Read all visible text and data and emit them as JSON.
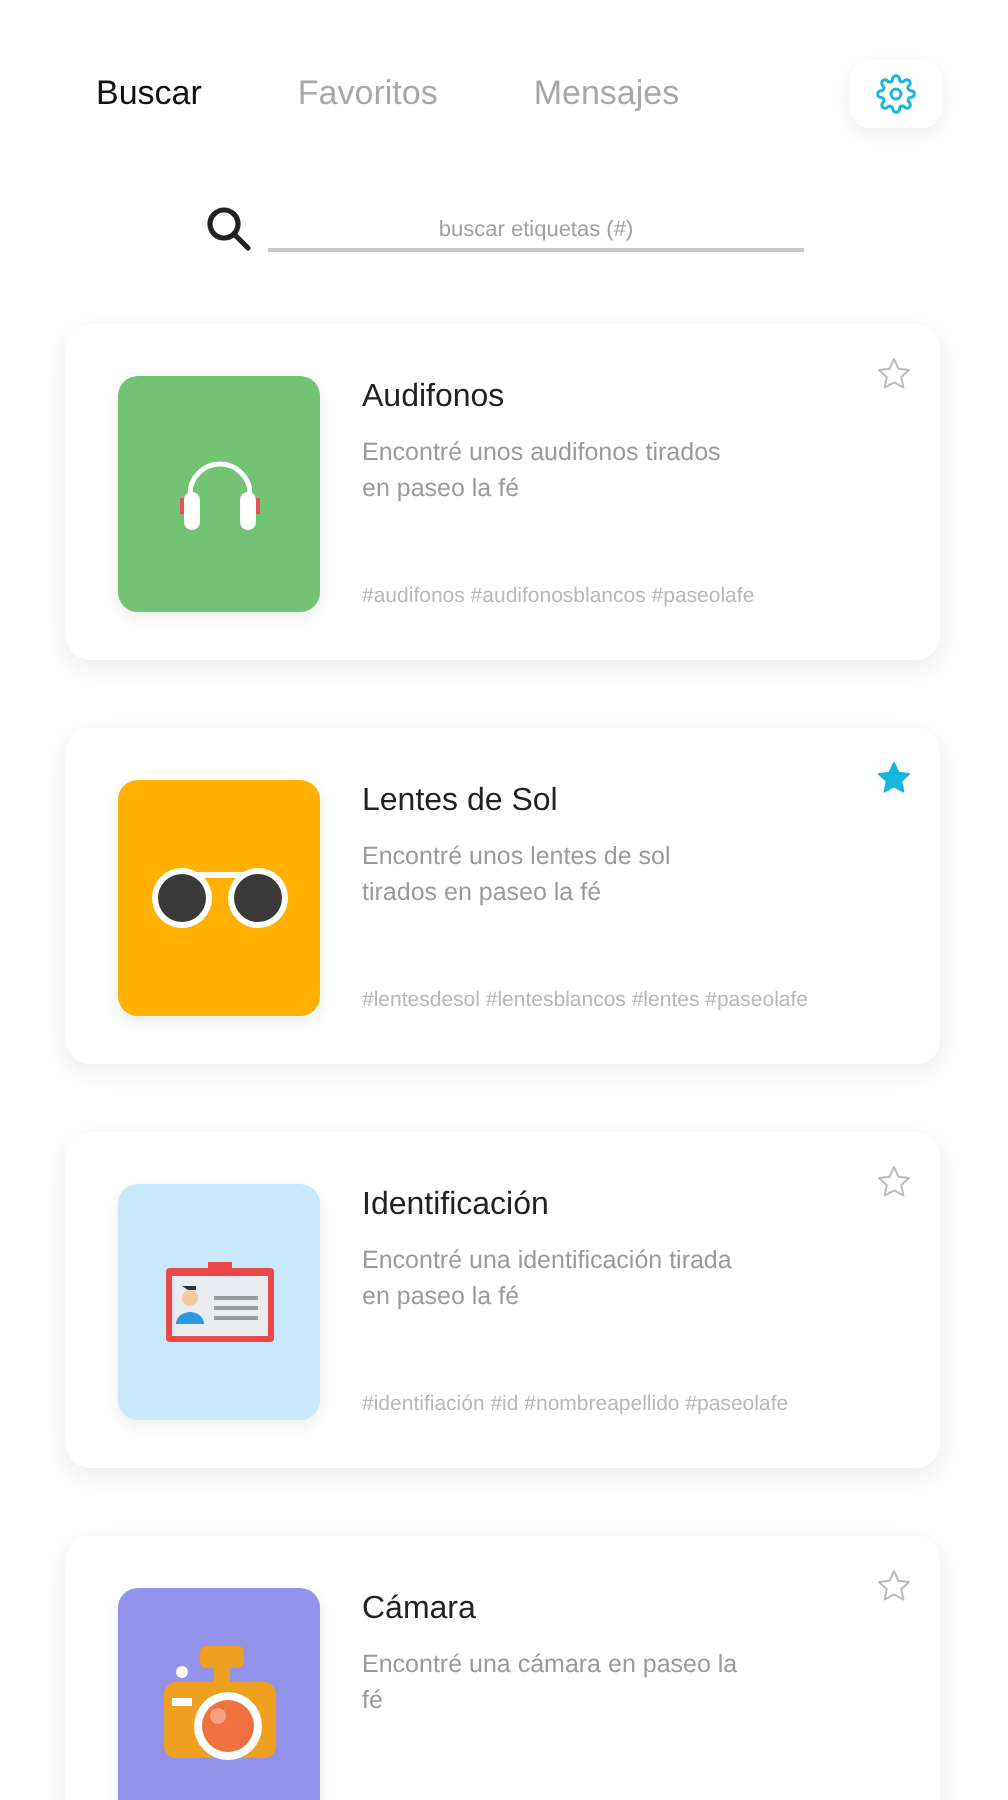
{
  "tabs": [
    {
      "label": "Buscar",
      "selected": true
    },
    {
      "label": "Favoritos",
      "selected": false
    },
    {
      "label": "Mensajes",
      "selected": false
    }
  ],
  "search": {
    "placeholder": "buscar etiquetas (#)"
  },
  "items": [
    {
      "title": "Audifonos",
      "kind": "headphones",
      "color": "#72c472",
      "description": "Encontré unos audifonos tirados en paseo la fé",
      "tags": "#audifonos #audifonosblancos  #paseolafe",
      "favorite": false
    },
    {
      "title": "Lentes de Sol",
      "kind": "sunglasses",
      "color": "#ffb000",
      "description": "Encontré unos lentes de sol tirados en paseo la fé",
      "tags": "#lentesdesol #lentesblancos #lentes #paseolafe",
      "favorite": true
    },
    {
      "title": "Identificación",
      "kind": "id-card",
      "color": "#c8e8fc",
      "description": "Encontré una identificación tirada en paseo la fé",
      "tags": "#identifiación #id #nombreapellido #paseolafe",
      "favorite": false
    },
    {
      "title": "Cámara",
      "kind": "camera",
      "color": "#9393ec",
      "description": "Encontré una cámara en paseo la fé",
      "favorite": false
    }
  ]
}
